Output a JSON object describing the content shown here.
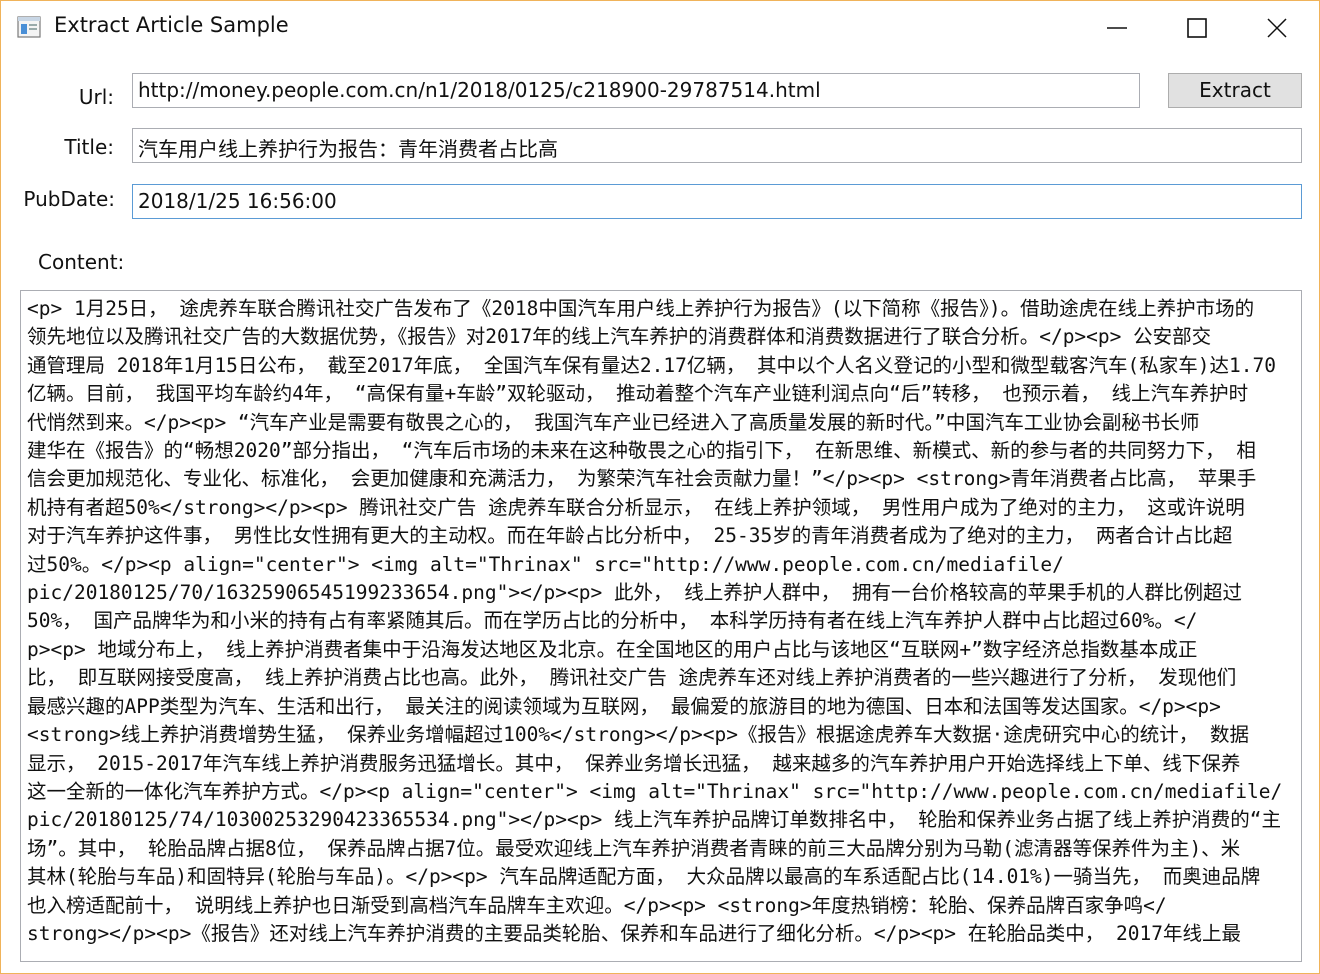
{
  "window": {
    "title": "Extract Article Sample",
    "icon": "app-window-icon",
    "controls": {
      "minimize": "minimize-icon",
      "maximize": "maximize-icon",
      "close": "close-icon"
    }
  },
  "form": {
    "url_label": "Url:",
    "url_value": "http://money.people.com.cn/n1/2018/0125/c218900-29787514.html",
    "extract_label": "Extract",
    "title_label": "Title:",
    "title_value": "汽车用户线上养护行为报告：青年消费者占比高",
    "pubdate_label": "PubDate:",
    "pubdate_value": "2018/1/25 16:56:00",
    "content_label": "Content:",
    "content_lines": [
      "<p> 1月25日， 途虎养车联合腾讯社交广告发布了《2018中国汽车用户线上养护行为报告》(以下简称《报告》)。借助途虎在线上养护市场的",
      "领先地位以及腾讯社交广告的大数据优势，《报告》对2017年的线上汽车养护的消费群体和消费数据进行了联合分析。</p><p> 公安部交",
      "通管理局 2018年1月15日公布， 截至2017年底， 全国汽车保有量达2.17亿辆， 其中以个人名义登记的小型和微型载客汽车(私家车)达1.70",
      "亿辆。目前， 我国平均车龄约4年， “高保有量+车龄”双轮驱动， 推动着整个汽车产业链利润点向“后”转移， 也预示着， 线上汽车养护时",
      "代悄然到来。</p><p> “汽车产业是需要有敬畏之心的， 我国汽车产业已经进入了高质量发展的新时代。”中国汽车工业协会副秘书长师",
      "建华在《报告》的“畅想2020”部分指出， “汽车后市场的未来在这种敬畏之心的指引下， 在新思维、新模式、新的参与者的共同努力下， 相",
      "信会更加规范化、专业化、标准化， 会更加健康和充满活力， 为繁荣汽车社会贡献力量！”</p><p> <strong>青年消费者占比高， 苹果手",
      "机持有者超50%</strong></p><p> 腾讯社交广告 途虎养车联合分析显示， 在线上养护领域， 男性用户成为了绝对的主力， 这或许说明",
      "对于汽车养护这件事， 男性比女性拥有更大的主动权。而在年龄占比分析中， 25-35岁的青年消费者成为了绝对的主力， 两者合计占比超",
      "过50%。</p><p align=\"center\"> <img alt=\"Thrinax\" src=\"http://www.people.com.cn/mediafile/",
      "pic/20180125/70/16325906545199233654.png\"></p><p> 此外， 线上养护人群中， 拥有一台价格较高的苹果手机的人群比例超过",
      "50%， 国产品牌华为和小米的持有占有率紧随其后。而在学历占比的分析中， 本科学历持有者在线上汽车养护人群中占比超过60%。</",
      "p><p> 地域分布上， 线上养护消费者集中于沿海发达地区及北京。在全国地区的用户占比与该地区“互联网+”数字经济总指数基本成正",
      "比， 即互联网接受度高， 线上养护消费占比也高。此外， 腾讯社交广告 途虎养车还对线上养护消费者的一些兴趣进行了分析， 发现他们",
      "最感兴趣的APP类型为汽车、生活和出行， 最关注的阅读领域为互联网， 最偏爱的旅游目的地为德国、日本和法国等发达国家。</p><p>",
      "<strong>线上养护消费增势生猛， 保养业务增幅超过100%</strong></p><p>《报告》根据途虎养车大数据·途虎研究中心的统计， 数据",
      "显示， 2015-2017年汽车线上养护消费服务迅猛增长。其中， 保养业务增长迅猛， 越来越多的汽车养护用户开始选择线上下单、线下保养",
      "这一全新的一体化汽车养护方式。</p><p align=\"center\"> <img alt=\"Thrinax\" src=\"http://www.people.com.cn/mediafile/",
      "pic/20180125/74/10300253290423365534.png\"></p><p> 线上汽车养护品牌订单数排名中， 轮胎和保养业务占据了线上养护消费的“主",
      "场”。其中， 轮胎品牌占据8位， 保养品牌占据7位。最受欢迎线上汽车养护消费者青睐的前三大品牌分别为马勒(滤清器等保养件为主)、米",
      "其林(轮胎与车品)和固特异(轮胎与车品)。</p><p> 汽车品牌适配方面， 大众品牌以最高的车系适配占比(14.01%)一骑当先， 而奥迪品牌",
      "也入榜适配前十， 说明线上养护也日渐受到高档汽车品牌车主欢迎。</p><p> <strong>年度热销榜：轮胎、保养品牌百家争鸣</",
      "strong></p><p>《报告》还对线上汽车养护消费的主要品类轮胎、保养和车品进行了细化分析。</p><p> 在轮胎品类中， 2017年线上最"
    ]
  }
}
